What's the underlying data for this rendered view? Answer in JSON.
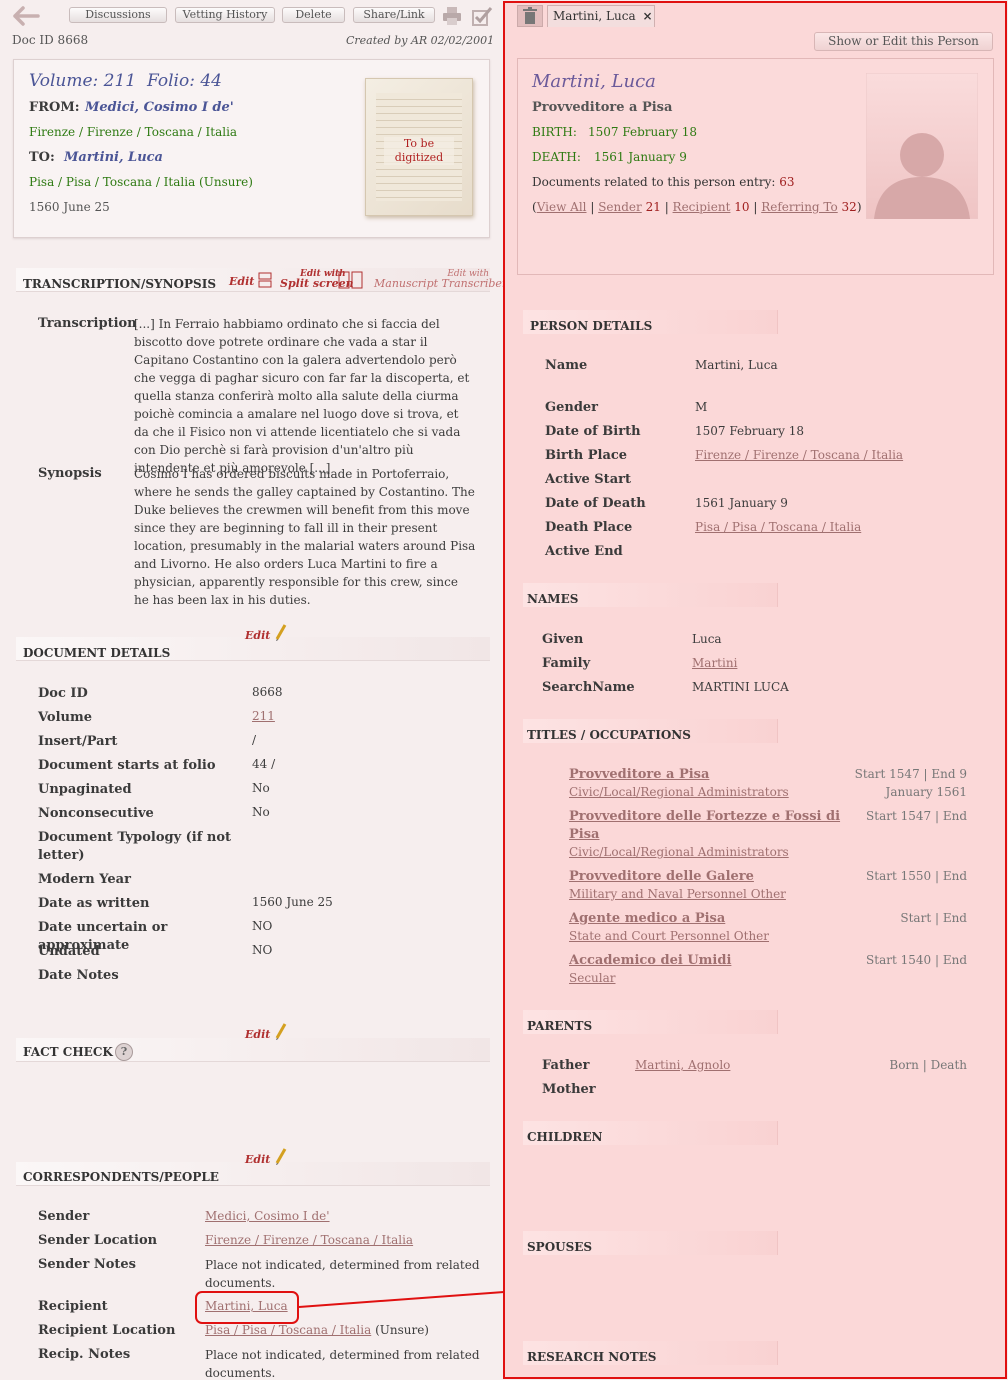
{
  "toolbar": {
    "discussions": "Discussions",
    "vetting_history": "Vetting History",
    "delete": "Delete",
    "share_link": "Share/Link"
  },
  "doc": {
    "doc_id_label": "Doc ID 8668",
    "created_by": "Created by AR 02/02/2001",
    "volume": "Volume: 211",
    "folio": "Folio: 44",
    "from_label": "FROM:",
    "from_name": "Medici, Cosimo I de'",
    "from_place": "Firenze / Firenze / Toscana / Italia",
    "to_label": "TO:",
    "to_name": "Martini, Luca",
    "to_place": "Pisa / Pisa / Toscana / Italia (Unsure)",
    "date": "1560 June 25",
    "thumb_text": "To be digitized"
  },
  "transcription": {
    "header": "TRANSCRIPTION/SYNOPSIS",
    "edit": "Edit",
    "edit_with": "Edit with",
    "split_screen": "Split screen",
    "edit_with2": "Edit with",
    "manuscript_transcriber": "Manuscript Transcriber",
    "transcription_label": "Transcription",
    "transcription_text": "[...] In Ferraio habbiamo ordinato che si faccia del biscotto dove potrete ordinare che vada a star il Capitano Costantino con la galera advertendolo però che vegga di paghar sicuro con far far la discoperta, et quella stanza conferirà molto alla salute della ciurma poichè comincia a amalare nel luogo dove si trova, et da che il Fisico non vi attende licentiatelo che si vada con Dio perchè si farà provision d'un'altro più intendente et più amorevole [...]",
    "synopsis_label": "Synopsis",
    "synopsis_text": "Cosimo I has ordered biscuits made in Portoferraio, where he sends the galley captained by Costantino. The Duke believes the crewmen will benefit from this move since they are beginning to fall ill in their present location, presumably in the malarial waters around Pisa and Livorno. He also orders Luca Martini to fire a physician, apparently responsible for this crew, since he has been lax in his duties."
  },
  "document_details": {
    "header": "DOCUMENT DETAILS",
    "edit": "Edit",
    "rows": [
      {
        "label": "Doc ID",
        "value": "8668"
      },
      {
        "label": "Volume",
        "value": "211"
      },
      {
        "label": "Insert/Part",
        "value": "/"
      },
      {
        "label": "Document starts at folio",
        "value": "44 /"
      },
      {
        "label": "Unpaginated",
        "value": "No"
      },
      {
        "label": "Nonconsecutive",
        "value": "No"
      },
      {
        "label": "Document Typology (if not letter)",
        "value": ""
      },
      {
        "label": "Modern Year",
        "value": ""
      },
      {
        "label": "Date as written",
        "value": "1560 June 25"
      },
      {
        "label": "Date uncertain or approximate",
        "value": "NO"
      },
      {
        "label": "Undated",
        "value": "NO"
      },
      {
        "label": "Date Notes",
        "value": ""
      }
    ]
  },
  "fact_check": {
    "header": "FACT CHECK",
    "edit": "Edit",
    "help": "?"
  },
  "correspondents": {
    "header": "CORRESPONDENTS/PEOPLE",
    "edit": "Edit",
    "sender_label": "Sender",
    "sender": "Medici, Cosimo I de'",
    "sender_location_label": "Sender Location",
    "sender_location": "Firenze / Firenze / Toscana / Italia",
    "sender_notes_label": "Sender Notes",
    "sender_notes": "Place not indicated, determined from related documents.",
    "recipient_label": "Recipient",
    "recipient": "Martini, Luca",
    "recipient_location_label": "Recipient Location",
    "recipient_location": "Pisa / Pisa / Toscana / Italia",
    "recipient_location_suffix": "(Unsure)",
    "recip_notes_label": "Recip. Notes",
    "recip_notes": "Place not indicated, determined from related documents."
  },
  "person_panel": {
    "tab_label": "Martini, Luca",
    "show_edit": "Show or Edit this Person",
    "name": "Martini, Luca",
    "title": "Provveditore a Pisa",
    "birth_label": "BIRTH:",
    "birth": "1507 February 18",
    "death_label": "DEATH:",
    "death": "1561 January 9",
    "docs_related": "Documents related to this person entry:",
    "docs_count": "63",
    "view_all": "View All",
    "sender": "Sender",
    "sender_count": "21",
    "recipient": "Recipient",
    "recipient_count": "10",
    "referring_to": "Referring To",
    "referring_count": "32"
  },
  "person_details": {
    "header": "PERSON DETAILS",
    "rows": [
      {
        "label": "Name",
        "value": "Martini, Luca",
        "link": false
      },
      {
        "label": "Gender",
        "value": "M",
        "link": false
      },
      {
        "label": "Date of Birth",
        "value": "1507 February 18",
        "link": false
      },
      {
        "label": "Birth Place",
        "value": "Firenze / Firenze / Toscana / Italia",
        "link": true
      },
      {
        "label": "Active Start",
        "value": "",
        "link": false
      },
      {
        "label": "Date of Death",
        "value": "1561 January 9",
        "link": false
      },
      {
        "label": "Death Place",
        "value": "Pisa / Pisa / Toscana / Italia",
        "link": true
      },
      {
        "label": "Active End",
        "value": "",
        "link": false
      }
    ]
  },
  "names": {
    "header": "NAMES",
    "rows": [
      {
        "label": "Given",
        "value": "Luca",
        "link": false
      },
      {
        "label": "Family",
        "value": "Martini",
        "link": true
      },
      {
        "label": "SearchName",
        "value": "MARTINI LUCA",
        "link": false
      }
    ]
  },
  "titles": {
    "header": "TITLES / OCCUPATIONS",
    "items": [
      {
        "title": "Provveditore a Pisa",
        "category": "Civic/Local/Regional Administrators",
        "dates": "Start 1547 | End 9",
        "dates2": "January 1561"
      },
      {
        "title": "Provveditore delle Fortezze e Fossi di",
        "title2": "Pisa",
        "category": "Civic/Local/Regional Administrators",
        "dates": "Start 1547 | End"
      },
      {
        "title": "Provveditore delle Galere",
        "category": "Military and Naval Personnel Other",
        "dates": "Start 1550 | End"
      },
      {
        "title": "Agente medico a Pisa",
        "category": "State and Court Personnel Other",
        "dates": "Start | End"
      },
      {
        "title": "Accademico dei Umidi",
        "category": "Secular",
        "dates": "Start 1540 | End"
      }
    ]
  },
  "parents": {
    "header": "PARENTS",
    "father_label": "Father",
    "father": "Martini, Agnolo",
    "father_dates": "Born | Death",
    "mother_label": "Mother"
  },
  "children": {
    "header": "CHILDREN"
  },
  "spouses": {
    "header": "SPOUSES"
  },
  "research_notes": {
    "header": "RESEARCH NOTES"
  },
  "colors": {
    "highlight": "#e01010",
    "link": "#a07070",
    "place": "#2e7a12",
    "name": "#4b5596",
    "panel": "#fbd8d8"
  }
}
